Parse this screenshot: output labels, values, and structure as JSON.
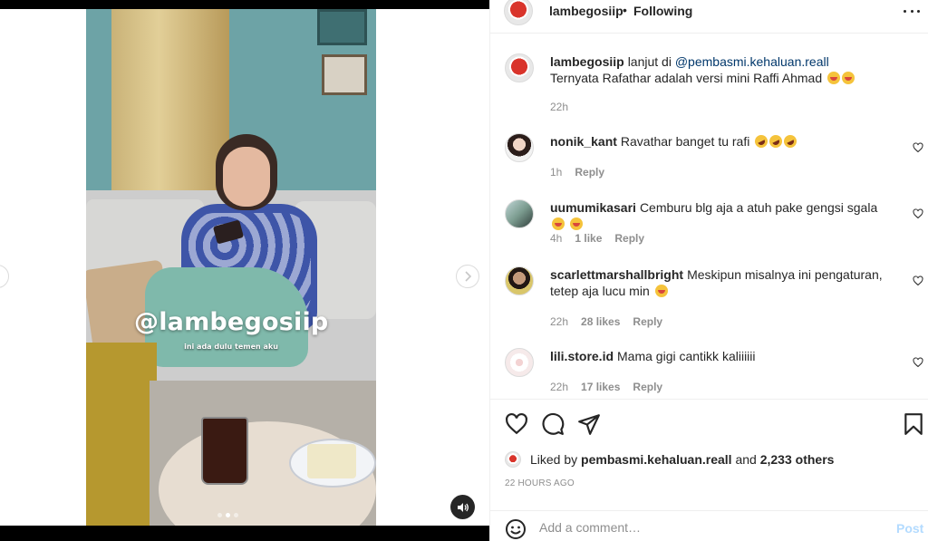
{
  "media": {
    "watermark": "@lambegosiip",
    "subtitle": "ini ada dulu temen aku",
    "carousel": {
      "total": 3,
      "active_index": 1
    }
  },
  "header": {
    "username": "lambegosiip",
    "separator": "•",
    "follow_status": "Following"
  },
  "caption": {
    "username": "lambegosiip",
    "text_prefix": "lanjut di ",
    "mention": "@pembasmi.kehaluan.reall",
    "line2": "Ternyata Rafathar adalah versi mini Raffi Ahmad",
    "time": "22h"
  },
  "comments": [
    {
      "username": "nonik_kant",
      "text": "Ravathar banget tu rafi",
      "emojis": 3,
      "emoji_type": "rofl",
      "time": "1h",
      "likes": "",
      "reply": "Reply"
    },
    {
      "username": "uumumikasari",
      "text": "Cemburu blg aja a atuh pake gengsi sgala",
      "emojis": 2,
      "emoji_type": "laugh",
      "time": "4h",
      "likes": "1 like",
      "reply": "Reply"
    },
    {
      "username": "scarlettmarshallbright",
      "text": "Meskipun misalnya ini pengaturan, tetep aja lucu min",
      "emojis": 1,
      "emoji_type": "laugh",
      "time": "22h",
      "likes": "28 likes",
      "reply": "Reply"
    },
    {
      "username": "lili.store.id",
      "text": "Mama gigi cantikk kaliiiiii",
      "emojis": 0,
      "emoji_type": "",
      "time": "22h",
      "likes": "17 likes",
      "reply": "Reply"
    }
  ],
  "likes": {
    "prefix": "Liked by",
    "user": "pembasmi.kehaluan.reall",
    "and": "and",
    "others": "2,233 others"
  },
  "timestamp": "22 HOURS AGO",
  "add_comment": {
    "placeholder": "Add a comment…",
    "post_label": "Post"
  },
  "colors": {
    "link": "#00376b",
    "post_disabled": "#b3dbff",
    "muted": "#8e8e8e"
  },
  "icons": [
    "heart-icon",
    "comment-icon",
    "share-icon",
    "bookmark-icon",
    "emoji-icon",
    "more-icon",
    "mute-icon",
    "chevron-right-icon"
  ]
}
